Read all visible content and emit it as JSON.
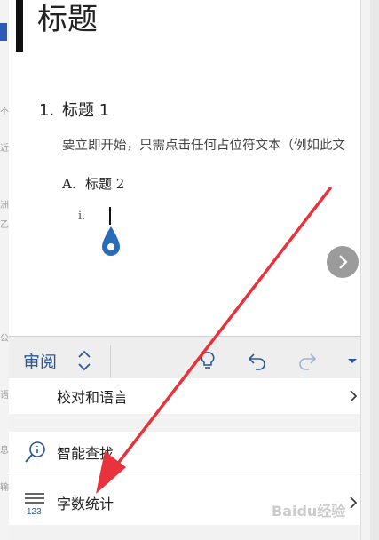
{
  "document": {
    "title": "标题",
    "heading1": {
      "number": "1.",
      "text": "标题 1"
    },
    "body": "要立即开始，只需点击任何占位符文本（例如此文",
    "heading2": {
      "number": "A.",
      "text": "标题 2"
    },
    "heading3_number": "i."
  },
  "toolbar": {
    "active_tab": "审阅",
    "icons": [
      "updown-icon",
      "lightbulb-icon",
      "undo-icon",
      "redo-icon",
      "more-dropdown-icon"
    ]
  },
  "menu": {
    "items": [
      {
        "label": "校对和语言",
        "icon": ""
      },
      {
        "label": "智能查找",
        "icon": "search-insight-icon"
      },
      {
        "label": "字数统计",
        "icon": "word-count-icon"
      }
    ]
  },
  "background_chars": [
    "不",
    "近",
    "洲",
    "乙",
    "公",
    "语",
    "息",
    "输"
  ],
  "watermark": "Baidu经验",
  "colors": {
    "accent": "#2b5797",
    "arrow": "#e8323c",
    "cursor": "#2a6bb8"
  }
}
